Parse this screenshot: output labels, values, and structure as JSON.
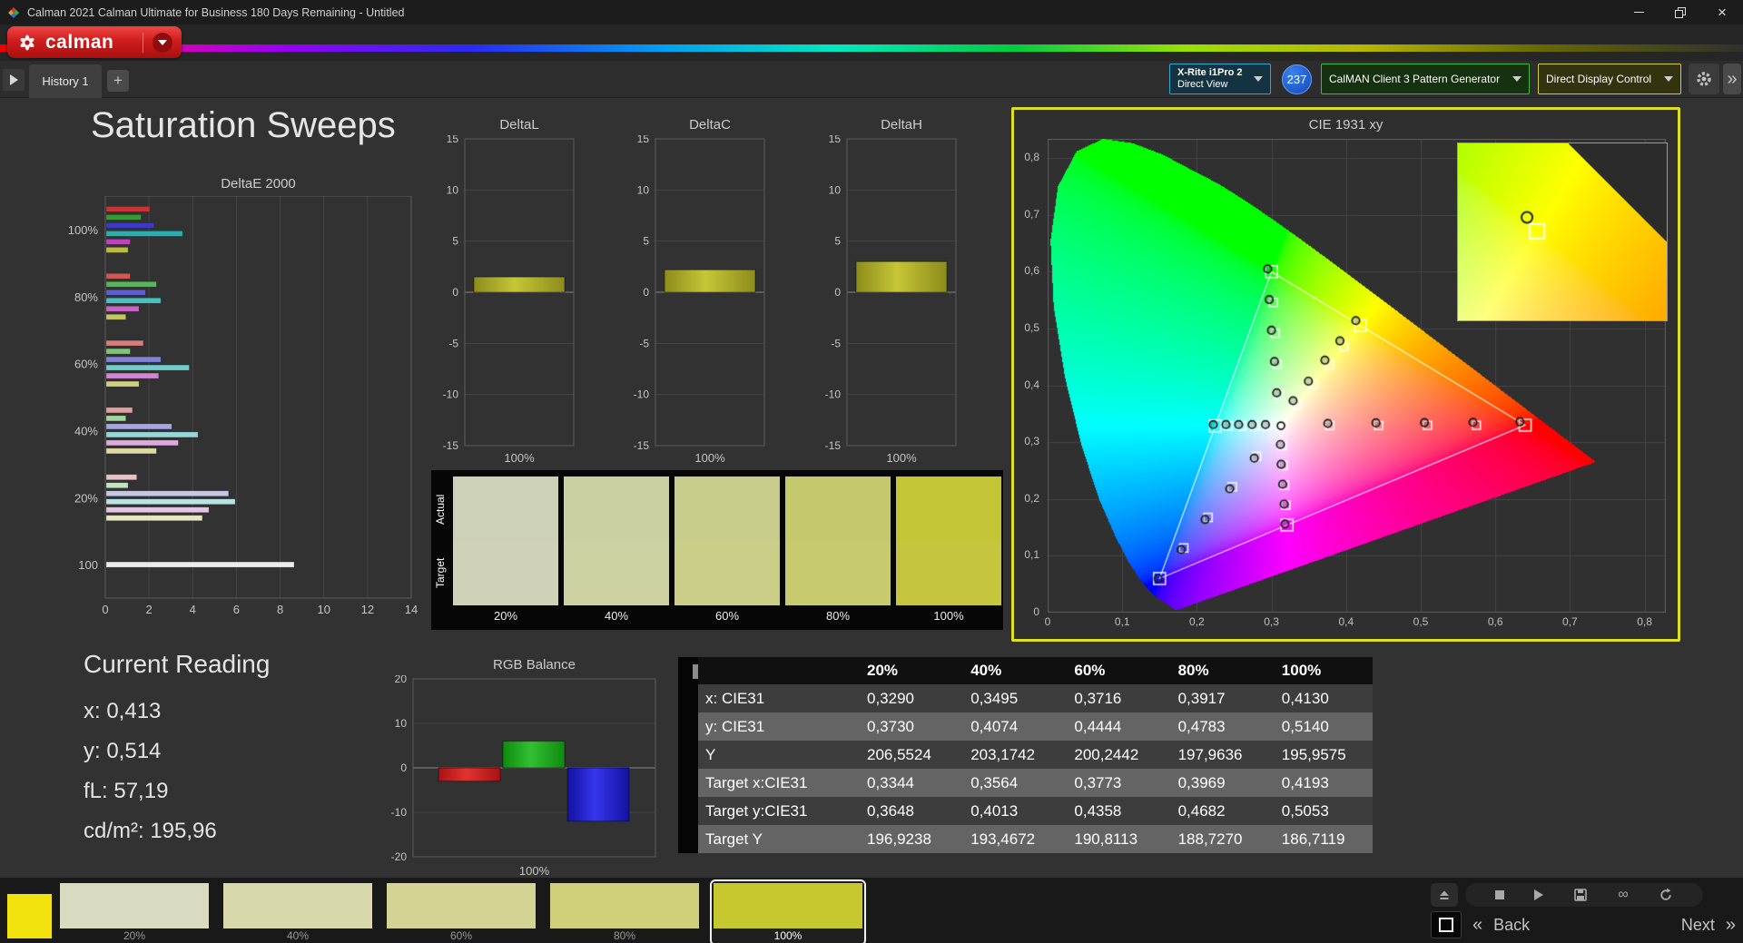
{
  "window": {
    "title": "Calman 2021 Calman Ultimate for Business 180 Days Remaining - Untitled"
  },
  "brand": {
    "name": "calman"
  },
  "tabs": {
    "history": "History 1",
    "add": "+"
  },
  "toolbar": {
    "meter": {
      "line1": "X-Rite i1Pro 2",
      "line2": "Direct View",
      "badge": "237"
    },
    "pattern_generator": "CalMAN Client 3 Pattern Generator",
    "display_control": "Direct Display Control"
  },
  "page": {
    "title": "Saturation Sweeps"
  },
  "current_reading": {
    "title": "Current Reading",
    "x": "x: 0,413",
    "y": "y: 0,514",
    "fl": "fL: 57,19",
    "cdm2": "cd/m²: 195,96"
  },
  "swatch_strip": {
    "row_labels": [
      "Actual",
      "Target"
    ],
    "columns": [
      "20%",
      "40%",
      "60%",
      "80%",
      "100%"
    ],
    "actual_colors": [
      "#cdd1b8",
      "#cbcfa2",
      "#c8cc8a",
      "#c5c96e",
      "#c3c436"
    ],
    "target_colors": [
      "#cfd2b6",
      "#ced1a1",
      "#cbce89",
      "#c7cb6d",
      "#c5c63e"
    ]
  },
  "results_table": {
    "columns": [
      "20%",
      "40%",
      "60%",
      "80%",
      "100%"
    ],
    "rows": [
      {
        "label": "x: CIE31",
        "values": [
          "0,3290",
          "0,3495",
          "0,3716",
          "0,3917",
          "0,4130"
        ]
      },
      {
        "label": "y: CIE31",
        "values": [
          "0,3730",
          "0,4074",
          "0,4444",
          "0,4783",
          "0,5140"
        ]
      },
      {
        "label": "Y",
        "values": [
          "206,5524",
          "203,1742",
          "200,2442",
          "197,9636",
          "195,9575"
        ]
      },
      {
        "label": "Target x:CIE31",
        "values": [
          "0,3344",
          "0,3564",
          "0,3773",
          "0,3969",
          "0,4193"
        ]
      },
      {
        "label": "Target y:CIE31",
        "values": [
          "0,3648",
          "0,4013",
          "0,4358",
          "0,4682",
          "0,5053"
        ]
      },
      {
        "label": "Target Y",
        "values": [
          "196,9238",
          "193,4672",
          "190,8113",
          "188,7270",
          "186,7119"
        ]
      }
    ]
  },
  "bottom_bar": {
    "corner_color": "#f2e30e",
    "swatches": [
      {
        "label": "20%",
        "color": "#d9dbc0"
      },
      {
        "label": "40%",
        "color": "#d7d8ab"
      },
      {
        "label": "60%",
        "color": "#d3d494"
      },
      {
        "label": "80%",
        "color": "#d0d07a"
      },
      {
        "label": "100%",
        "color": "#c7c830",
        "selected": true
      }
    ],
    "back_label": "Back",
    "next_label": "Next"
  },
  "chart_data": [
    {
      "id": "deltae2000",
      "type": "bar",
      "orientation": "horizontal",
      "title": "DeltaE 2000",
      "xlim": [
        0,
        14
      ],
      "xticks": [
        0,
        2,
        4,
        6,
        8,
        10,
        12,
        14
      ],
      "groups": [
        {
          "label": "100%",
          "bars": [
            {
              "color": "#c63434",
              "value": 2.0
            },
            {
              "color": "#2f9e2f",
              "value": 1.6
            },
            {
              "color": "#3a3ac6",
              "value": 2.2
            },
            {
              "color": "#28b0b0",
              "value": 3.5
            },
            {
              "color": "#bc44bc",
              "value": 1.1
            },
            {
              "color": "#bcbc3a",
              "value": 1.0
            }
          ]
        },
        {
          "label": "80%",
          "bars": [
            {
              "color": "#d05858",
              "value": 1.1
            },
            {
              "color": "#57b657",
              "value": 2.3
            },
            {
              "color": "#5e5ed0",
              "value": 1.8
            },
            {
              "color": "#4cc0c0",
              "value": 2.5
            },
            {
              "color": "#c864c8",
              "value": 1.5
            },
            {
              "color": "#c6c65e",
              "value": 0.9
            }
          ]
        },
        {
          "label": "60%",
          "bars": [
            {
              "color": "#d87c7c",
              "value": 1.7
            },
            {
              "color": "#7cc67c",
              "value": 1.1
            },
            {
              "color": "#8282d8",
              "value": 2.5
            },
            {
              "color": "#72cccc",
              "value": 3.8
            },
            {
              "color": "#d286d2",
              "value": 2.4
            },
            {
              "color": "#d0d080",
              "value": 1.5
            }
          ]
        },
        {
          "label": "40%",
          "bars": [
            {
              "color": "#e0a0a0",
              "value": 1.2
            },
            {
              "color": "#a0d6a0",
              "value": 0.9
            },
            {
              "color": "#a6a6e0",
              "value": 3.0
            },
            {
              "color": "#96d8d8",
              "value": 4.2
            },
            {
              "color": "#dcaadc",
              "value": 3.3
            },
            {
              "color": "#dcdca2",
              "value": 2.3
            }
          ]
        },
        {
          "label": "20%",
          "bars": [
            {
              "color": "#e6c2c2",
              "value": 1.4
            },
            {
              "color": "#c2e4c2",
              "value": 1.0
            },
            {
              "color": "#c8c8e6",
              "value": 5.6
            },
            {
              "color": "#bae4e4",
              "value": 5.9
            },
            {
              "color": "#e4c6e4",
              "value": 4.7
            },
            {
              "color": "#e6e6c0",
              "value": 4.4
            }
          ]
        },
        {
          "label": "100",
          "bars": [
            {
              "color": "#ececec",
              "value": 8.6
            }
          ]
        }
      ]
    },
    {
      "id": "deltaL",
      "type": "bar",
      "title": "DeltaL",
      "ylim": [
        -15,
        15
      ],
      "yticks": [
        15,
        10,
        5,
        0,
        -5,
        -10,
        -15
      ],
      "categories": [
        "100%"
      ],
      "values": [
        1.5
      ],
      "bar_colors": [
        "#c6c636",
        "#8c8c1c"
      ]
    },
    {
      "id": "deltaC",
      "type": "bar",
      "title": "DeltaC",
      "ylim": [
        -15,
        15
      ],
      "yticks": [
        15,
        10,
        5,
        0,
        -5,
        -10,
        -15
      ],
      "categories": [
        "100%"
      ],
      "values": [
        2.2
      ],
      "bar_colors": [
        "#c6c636",
        "#8c8c1c"
      ]
    },
    {
      "id": "deltaH",
      "type": "bar",
      "title": "DeltaH",
      "ylim": [
        -15,
        15
      ],
      "yticks": [
        15,
        10,
        5,
        0,
        -5,
        -10,
        -15
      ],
      "categories": [
        "100%"
      ],
      "values": [
        3.0
      ],
      "bar_colors": [
        "#c6c636",
        "#8c8c1c"
      ]
    },
    {
      "id": "rgb_balance",
      "type": "bar",
      "title": "RGB Balance",
      "ylim": [
        -20,
        20
      ],
      "yticks": [
        20,
        10,
        0,
        -10,
        -20
      ],
      "categories": [
        "Red",
        "Green",
        "Blue"
      ],
      "values": [
        -3,
        6,
        -12
      ],
      "xlabel": "100%",
      "colors": [
        [
          "#e23232",
          "#a81212"
        ],
        [
          "#32c032",
          "#0f8a0f"
        ],
        [
          "#3636ee",
          "#1212a0"
        ]
      ]
    },
    {
      "id": "cie1931",
      "type": "scatter",
      "title": "CIE 1931 xy",
      "xlim": [
        0,
        0.8
      ],
      "ylim": [
        0,
        0.8
      ],
      "xticks": [
        "0",
        "0,1",
        "0,2",
        "0,3",
        "0,4",
        "0,5",
        "0,6",
        "0,7",
        "0,8"
      ],
      "yticks": [
        "0",
        "0,1",
        "0,2",
        "0,3",
        "0,4",
        "0,5",
        "0,6",
        "0,7",
        "0,8"
      ],
      "white_point": [
        0.3127,
        0.329
      ],
      "gamut_triangle": [
        [
          0.64,
          0.33
        ],
        [
          0.3,
          0.6
        ],
        [
          0.15,
          0.06
        ]
      ],
      "sweeps": [
        {
          "name": "red",
          "targets": [
            [
              0.3782,
              0.3292
            ],
            [
              0.4436,
              0.3294
            ],
            [
              0.5091,
              0.3296
            ],
            [
              0.5745,
              0.3298
            ],
            [
              0.64,
              0.33
            ]
          ],
          "measured": [
            [
              0.3755,
              0.333
            ],
            [
              0.44,
              0.334
            ],
            [
              0.505,
              0.3345
            ],
            [
              0.57,
              0.335
            ],
            [
              0.633,
              0.336
            ]
          ]
        },
        {
          "name": "green",
          "targets": [
            [
              0.3102,
              0.3832
            ],
            [
              0.3076,
              0.4374
            ],
            [
              0.3051,
              0.4916
            ],
            [
              0.3025,
              0.5458
            ],
            [
              0.3,
              0.6
            ]
          ],
          "measured": [
            [
              0.307,
              0.387
            ],
            [
              0.304,
              0.442
            ],
            [
              0.3,
              0.497
            ],
            [
              0.297,
              0.551
            ],
            [
              0.295,
              0.605
            ]
          ]
        },
        {
          "name": "blue",
          "targets": [
            [
              0.2802,
              0.2752
            ],
            [
              0.2476,
              0.2214
            ],
            [
              0.2151,
              0.1676
            ],
            [
              0.1825,
              0.1138
            ],
            [
              0.15,
              0.06
            ]
          ],
          "measured": [
            [
              0.277,
              0.272
            ],
            [
              0.244,
              0.218
            ],
            [
              0.211,
              0.164
            ],
            [
              0.179,
              0.111
            ],
            [
              0.148,
              0.06
            ]
          ]
        },
        {
          "name": "cyan",
          "targets": [
            [
              0.2951,
              0.3289
            ],
            [
              0.2775,
              0.3289
            ],
            [
              0.2598,
              0.3288
            ],
            [
              0.2422,
              0.3288
            ],
            [
              0.2246,
              0.3287
            ]
          ],
          "measured": [
            [
              0.292,
              0.331
            ],
            [
              0.274,
              0.331
            ],
            [
              0.256,
              0.331
            ],
            [
              0.239,
              0.331
            ],
            [
              0.222,
              0.331
            ]
          ]
        },
        {
          "name": "magenta",
          "targets": [
            [
              0.3143,
              0.294
            ],
            [
              0.316,
              0.2591
            ],
            [
              0.3176,
              0.2241
            ],
            [
              0.3193,
              0.1892
            ],
            [
              0.3209,
              0.1542
            ]
          ],
          "measured": [
            [
              0.312,
              0.296
            ],
            [
              0.313,
              0.261
            ],
            [
              0.315,
              0.226
            ],
            [
              0.317,
              0.191
            ],
            [
              0.318,
              0.156
            ]
          ]
        },
        {
          "name": "yellow",
          "targets": [
            [
              0.3344,
              0.3648
            ],
            [
              0.3564,
              0.4013
            ],
            [
              0.3773,
              0.4358
            ],
            [
              0.3969,
              0.4682
            ],
            [
              0.4193,
              0.5053
            ]
          ],
          "measured": [
            [
              0.329,
              0.373
            ],
            [
              0.3495,
              0.4074
            ],
            [
              0.3716,
              0.4444
            ],
            [
              0.3917,
              0.4783
            ],
            [
              0.413,
              0.514
            ]
          ]
        }
      ],
      "inset": {
        "x_range": [
          0.37,
          0.5
        ],
        "y_range": [
          0.45,
          0.56
        ],
        "target": [
          0.4193,
          0.5053
        ],
        "measured": [
          0.413,
          0.514
        ]
      }
    }
  ]
}
